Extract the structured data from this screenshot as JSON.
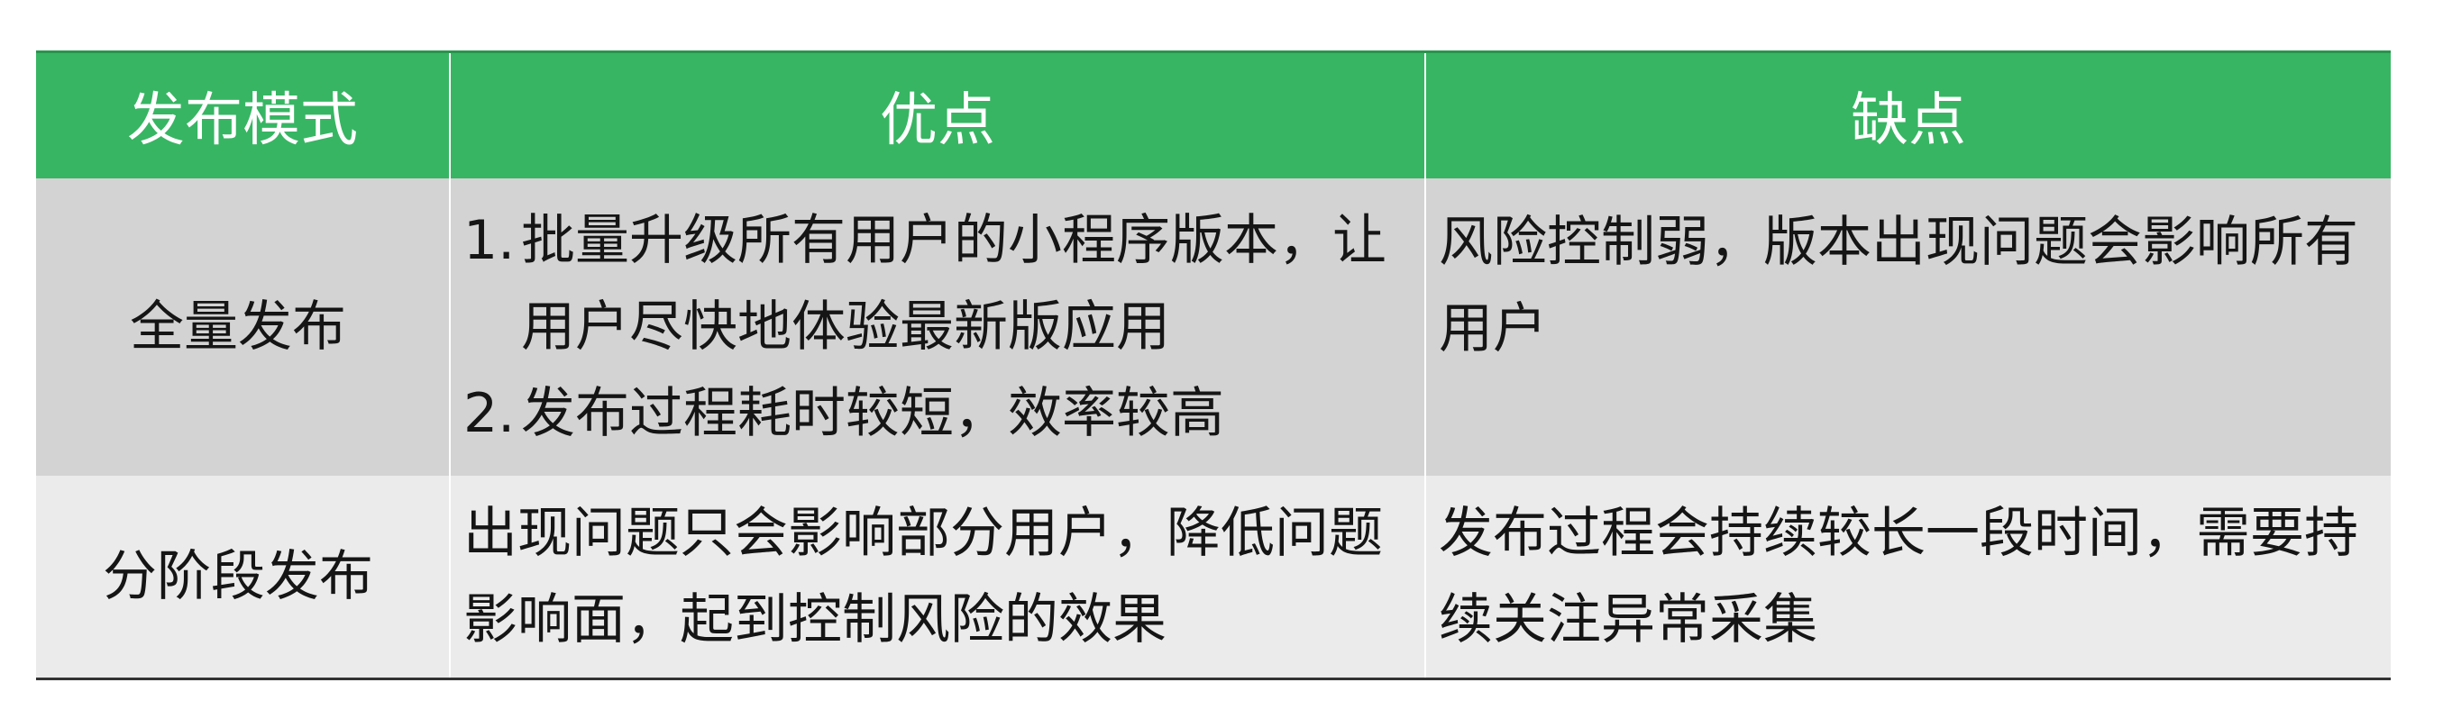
{
  "table": {
    "headers": [
      "发布模式",
      "优点",
      "缺点"
    ],
    "rows": [
      {
        "mode": "全量发布",
        "advantages": [
          {
            "num": "1.",
            "text": "批量升级所有用户的小程序版本，让用户尽快地体验最新版应用"
          },
          {
            "num": "2.",
            "text": "发布过程耗时较短，效率较高"
          }
        ],
        "disadvantages": "风险控制弱，版本出现问题会影响所有用户"
      },
      {
        "mode": "分阶段发布",
        "advantages_text": "出现问题只会影响部分用户，降低问题影响面，起到控制风险的效果",
        "disadvantages": "发布过程会持续较长一段时间，需要持续关注异常采集"
      }
    ]
  },
  "colors": {
    "header_bg": "#37b563",
    "header_text": "#ffffff",
    "row1_bg": "#d3d3d3",
    "row2_bg": "#ebebeb"
  }
}
